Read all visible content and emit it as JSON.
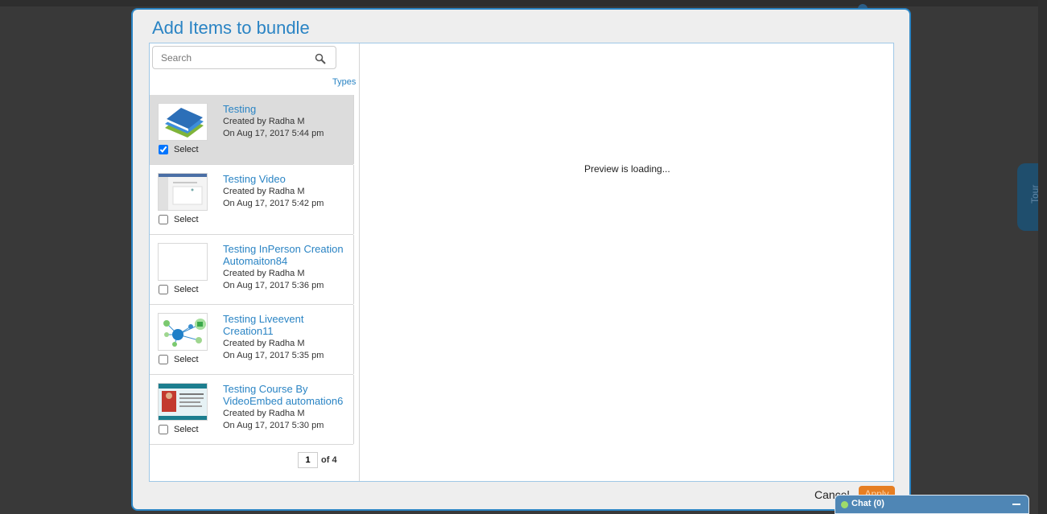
{
  "dialog": {
    "title": "Add Items to bundle",
    "search": {
      "placeholder": "Search",
      "value": ""
    },
    "types_link": "Types",
    "items": [
      {
        "title": "Testing",
        "created_by": "Created by Radha M",
        "date": "On Aug 17, 2017 5:44 pm",
        "checked": true,
        "select_label": "Select",
        "thumb": "books-icon"
      },
      {
        "title": "Testing Video",
        "created_by": "Created by Radha M",
        "date": "On Aug 17, 2017 5:42 pm",
        "checked": false,
        "select_label": "Select",
        "thumb": "video-screenshot"
      },
      {
        "title": "Testing InPerson Creation Automaiton84",
        "created_by": "Created by Radha M",
        "date": "On Aug 17, 2017 5:36 pm",
        "checked": false,
        "select_label": "Select",
        "thumb": "blank"
      },
      {
        "title": "Testing Liveevent Creation11",
        "created_by": "Created by Radha M",
        "date": "On Aug 17, 2017 5:35 pm",
        "checked": false,
        "select_label": "Select",
        "thumb": "network-icon"
      },
      {
        "title": "Testing Course By VideoEmbed automation6",
        "created_by": "Created by Radha M",
        "date": "On Aug 17, 2017 5:30 pm",
        "checked": false,
        "select_label": "Select",
        "thumb": "course-slide"
      }
    ],
    "pager": {
      "current_page": "1",
      "of_text": "of 4"
    },
    "preview_text": "Preview is loading...",
    "cancel_label": "Cancel",
    "apply_label": "Apply"
  },
  "side_tab": {
    "label": "Tour"
  },
  "chat": {
    "label": "Chat  (0)"
  },
  "colors": {
    "accent": "#2a84c4",
    "apply": "#e67e22",
    "chat": "#4f86b5",
    "backdrop": "#393939"
  }
}
